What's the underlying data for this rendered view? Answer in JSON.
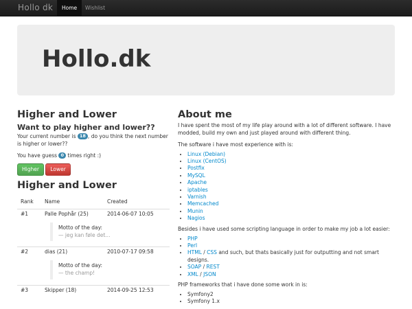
{
  "navbar": {
    "brand": "Hollo dk",
    "items": [
      "Home",
      "Wishlist"
    ]
  },
  "hero": {
    "title": "Hollo.dk"
  },
  "game": {
    "title": "Higher and Lower",
    "subtitle": "Want to play higher and lower??",
    "current_pre": "Your current number is",
    "current_number": "18",
    "current_post": ", do you think the next number is higher or lower??",
    "guess_pre": "You have guess",
    "guess_count": "0",
    "guess_post": "times right :)",
    "higher_label": "Higher",
    "lower_label": "Lower"
  },
  "scoreboard": {
    "title": "Higher and Lower",
    "columns": [
      "Rank",
      "Name",
      "Created"
    ],
    "motto_label": "Motto of the day:",
    "rows": [
      {
        "rank": "#1",
        "name": "Palle Pophår (25)",
        "created": "2014-06-07 10:05",
        "motto": "— jeg kan føle det..."
      },
      {
        "rank": "#2",
        "name": "dias (21)",
        "created": "2010-07-17 09:58",
        "motto": "— the champ!"
      },
      {
        "rank": "#3",
        "name": "Skipper (18)",
        "created": "2014-09-25 12:53"
      }
    ]
  },
  "about": {
    "title": "About me",
    "intro": "I have spent the most of my life play around with a lot of different software. I have modded, build my own and just played around with different thing.",
    "software_intro": "The software i have most experience with is:",
    "software": [
      "Linux (Debian)",
      "Linux (CentOS)",
      "Postfix",
      "MySQL",
      "Apache",
      "iptables",
      "Varnish",
      "Memcached",
      "Munin",
      "Nagios"
    ],
    "scripting_intro": "Besides i have used some scripting language in order to make my job a lot easier:",
    "scripting": {
      "php": "PHP",
      "perl": "Perl",
      "html": "HTML",
      "slash1": " / ",
      "css": "CSS",
      "html_rest": " and such, but thats basically just for outputting and not smart designs.",
      "soap": "SOAP",
      "slash2": " / ",
      "rest": "REST",
      "xml": "XML",
      "slash3": " / ",
      "json": "JSON"
    },
    "frameworks_intro": "PHP frameworks that i have done some work in is:",
    "frameworks": [
      "Symfony2",
      "Symfony 1.x"
    ]
  }
}
